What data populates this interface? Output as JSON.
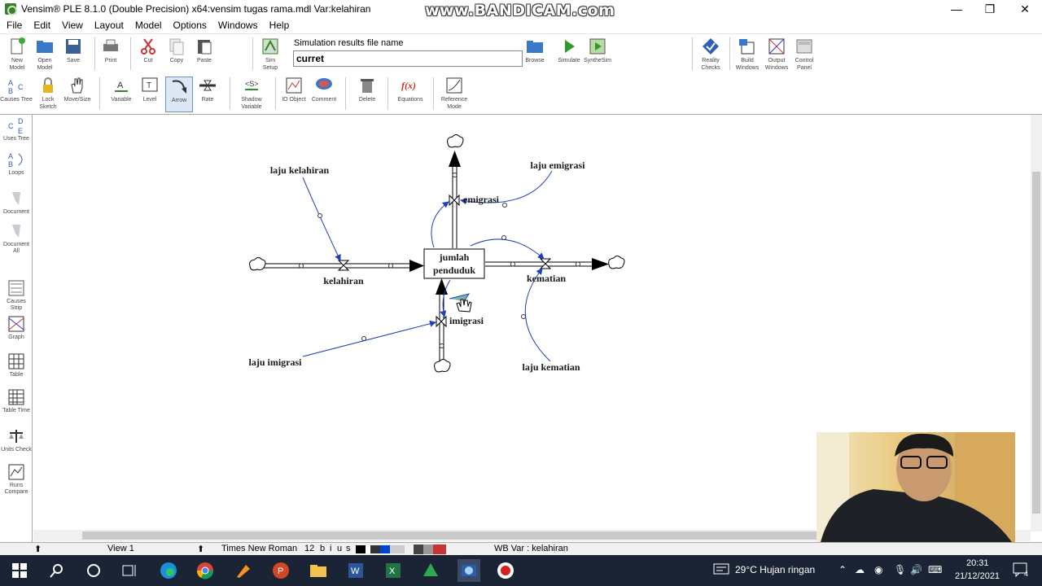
{
  "window": {
    "title": "Vensim® PLE 8.1.0 (Double Precision) x64:vensim tugas rama.mdl Var:kelahiran",
    "watermark": "www.BANDICAM.com"
  },
  "menu": [
    "File",
    "Edit",
    "View",
    "Layout",
    "Model",
    "Options",
    "Windows",
    "Help"
  ],
  "toolbar1": {
    "new_model": "New Model",
    "open_model": "Open Model",
    "save": "Save",
    "print": "Print",
    "cut": "Cut",
    "copy": "Copy",
    "paste": "Paste",
    "sim_setup": "Sim Setup",
    "sim_file_label": "Simulation results file name",
    "sim_file_value": "curret",
    "browse": "Browse",
    "simulate": "Simulate",
    "synthesim": "SyntheSim",
    "reality_checks": "Reality Checks",
    "build_windows": "Build Windows",
    "output_windows": "Output Windows",
    "control_panel": "Control Panel"
  },
  "toolbar2": {
    "lock_sketch": "Lock Sketch",
    "move_size": "Move/Size",
    "variable": "Variable",
    "level": "Level",
    "arrow": "Arrow",
    "rate": "Rate",
    "shadow_variable": "Shadow Variable",
    "io_object": "IO Object",
    "comment": "Comment",
    "delete": "Delete",
    "equations": "Equations",
    "reference_mode": "Reference Mode"
  },
  "left_tools": {
    "causes_tree": "Causes Tree",
    "uses_tree": "Uses Tree",
    "loops": "Loops",
    "document": "Document",
    "document_all": "Document All",
    "causes_strip": "Causes Strip",
    "graph": "Graph",
    "table": "Table",
    "table_time": "Table Time",
    "units_check": "Units Check",
    "runs_compare": "Runs Compare"
  },
  "diagram": {
    "stock": [
      "jumlah",
      "penduduk"
    ],
    "flows": {
      "kelahiran": "kelahiran",
      "kematian": "kematian",
      "emigrasi": "emigrasi",
      "imigrasi": "imigrasi"
    },
    "auxiliaries": {
      "laju_kelahiran": "laju kelahiran",
      "laju_emigrasi": "laju emigrasi",
      "laju_imigrasi": "laju imigrasi",
      "laju_kematian": "laju kematian"
    }
  },
  "statusbar": {
    "view": "View 1",
    "font": "Times New Roman",
    "font_size": "12",
    "bold": "b",
    "italic": "i",
    "underline": "u",
    "strike": "s",
    "wb_var": "WB Var : kelahiran"
  },
  "taskbar": {
    "weather": "29°C  Hujan ringan",
    "time": "20:31",
    "date": "21/12/2021",
    "notifications": "4"
  },
  "colors": {
    "taskbar_bg": "#1b2434",
    "link_arrow": "#1f3fbf",
    "flow_pipe": "#000000"
  }
}
